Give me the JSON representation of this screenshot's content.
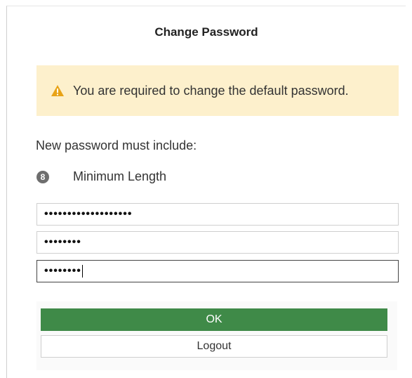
{
  "dialog": {
    "title": "Change Password",
    "warning": {
      "icon": "warning-icon",
      "text": "You are required to change the default password."
    },
    "requirements": {
      "heading": "New password must include:",
      "items": [
        {
          "badge": "8",
          "label": "Minimum Length"
        }
      ]
    },
    "fields": [
      {
        "name": "old-password",
        "value": "•••••••••••••••••••"
      },
      {
        "name": "new-password",
        "value": "••••••••"
      },
      {
        "name": "confirm-password",
        "value": "••••••••"
      }
    ],
    "buttons": {
      "ok": "OK",
      "logout": "Logout"
    }
  },
  "colors": {
    "warning_bg": "#fdf0cc",
    "warning_icon": "#e8a317",
    "ok_button": "#3f8a48"
  }
}
